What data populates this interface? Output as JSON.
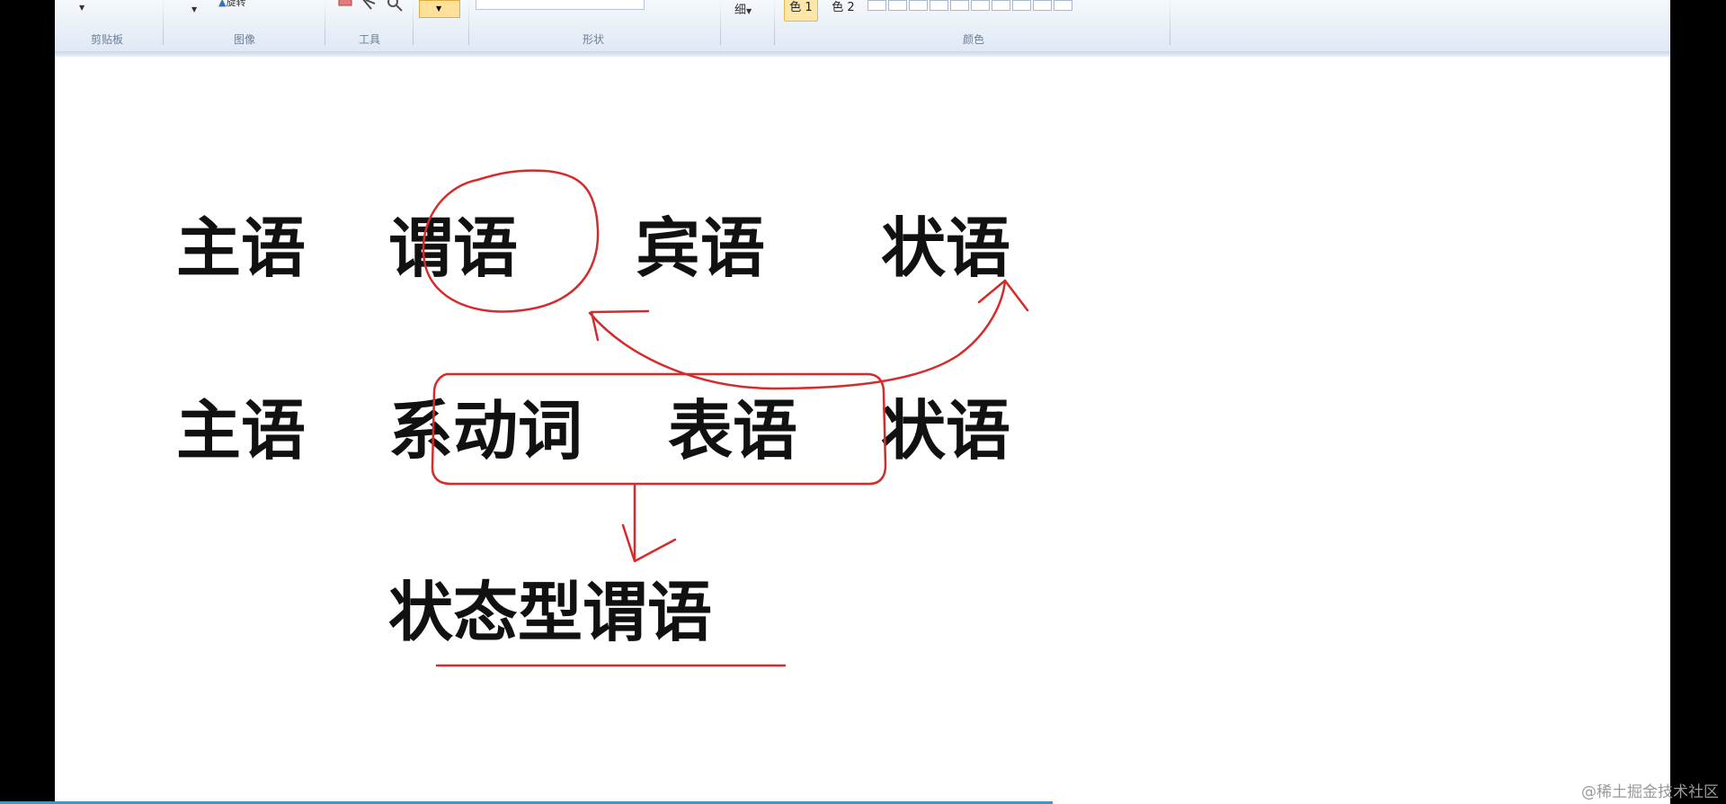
{
  "ribbon": {
    "groups": {
      "clipboard": "剪贴板",
      "image": "图像",
      "tools": "工具",
      "shapes": "形状",
      "colors": "颜色"
    },
    "size_label": "细",
    "color1_label": "色 1",
    "color2_label": "色 2",
    "rotate_label": "旋转"
  },
  "canvas": {
    "row1": [
      "主语",
      "谓语",
      "宾语",
      "状语"
    ],
    "row2": [
      "主语",
      "系动词",
      "表语",
      "状语"
    ],
    "result": "状态型谓语"
  },
  "colors": {
    "ink": "#d52b2b",
    "text": "#111111",
    "progress": "#1aa3de"
  },
  "video": {
    "progress_fraction": 0.61
  },
  "watermark": "@稀土掘金技术社区"
}
